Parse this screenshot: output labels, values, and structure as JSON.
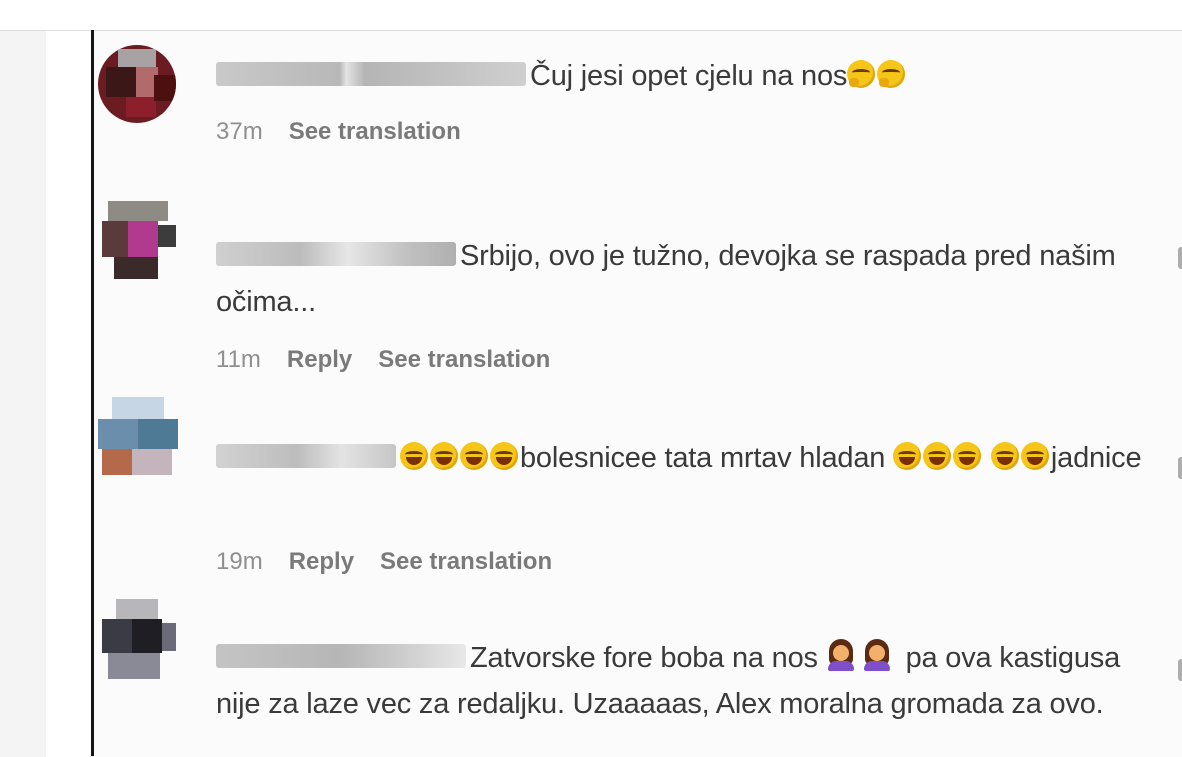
{
  "comments": [
    {
      "text": "Čuj jesi opet cjelu na nos",
      "emojis_after": [
        "thinking-face",
        "thinking-face"
      ],
      "time": "37m",
      "reply": "",
      "translate": "See translation"
    },
    {
      "text": "Srbijo, ovo je tužno, devojka se raspada pred našim očima...",
      "time": "11m",
      "reply": "Reply",
      "translate": "See translation"
    },
    {
      "emojis_before": [
        "tears-of-joy",
        "tears-of-joy",
        "tears-of-joy",
        "tears-of-joy"
      ],
      "text_part1": "bolesnicee tata mrtav hladan",
      "emojis_middle": [
        "tears-of-joy",
        "tears-of-joy",
        "tears-of-joy",
        "tears-of-joy",
        "tears-of-joy"
      ],
      "text_part2": "jadnice",
      "time": "19m",
      "reply": "Reply",
      "translate": "See translation"
    },
    {
      "text_part1": "Zatvorske fore boba na nos",
      "emojis_middle": [
        "woman-facepalming",
        "woman-facepalming"
      ],
      "text_part2": "pa ova kastigusa nije za laze vec za redaljku. Uzaaaaas, Alex moralna gromada za ovo."
    }
  ]
}
